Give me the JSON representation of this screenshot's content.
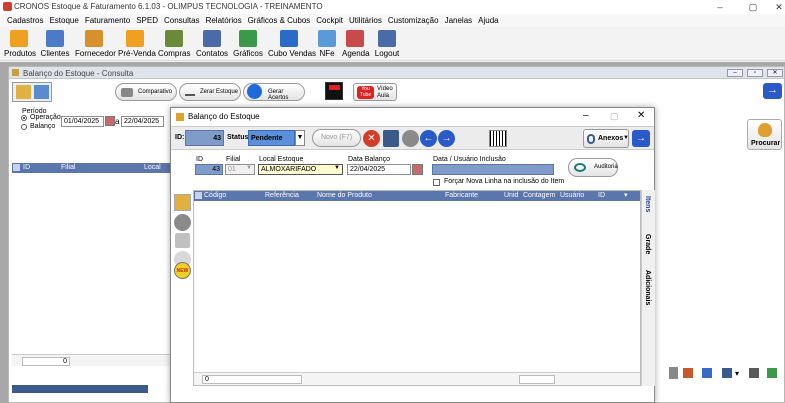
{
  "app": {
    "title": "CRONOS Estoque & Faturamento 6.1.03 - OLIMPUS TECNOLOGIA - TREINAMENTO",
    "window_controls": [
      "–",
      "▢",
      "✕"
    ]
  },
  "menu": [
    "Cadastros",
    "Estoque",
    "Faturamento",
    "SPED",
    "Consultas",
    "Relatórios",
    "Gráficos & Cubos",
    "Cockpit",
    "Utilitários",
    "Customização",
    "Janelas",
    "Ajuda"
  ],
  "toolbar": [
    {
      "label": "Produtos",
      "color": "#f0a020"
    },
    {
      "label": "Clientes",
      "color": "#4a7ac8"
    },
    {
      "label": "Fornecedor",
      "color": "#d8902a"
    },
    {
      "label": "Pré-Venda",
      "color": "#f0a020"
    },
    {
      "label": "Compras",
      "color": "#6a8a3a"
    },
    {
      "label": "Contatos",
      "color": "#4a6aa8"
    },
    {
      "label": "Gráficos",
      "color": "#3a9a4a"
    },
    {
      "label": "Cubo Vendas",
      "color": "#2a6ac8"
    },
    {
      "label": "NFe",
      "color": "#5a9ad8"
    },
    {
      "label": "Agenda",
      "color": "#c84a4a"
    },
    {
      "label": "Logout",
      "color": "#4a6aa8"
    }
  ],
  "consulta": {
    "title": "Balanço do Estoque - Consulta",
    "btn_comparativo": "Comparativo",
    "btn_zerar": "Zerar Estoque",
    "btn_gerar": "Gerar Acertos",
    "btn_video_logo": "You Tube",
    "btn_video": "Vídeo Aula",
    "periodo_label": "Período",
    "radio_operacao": "Operação",
    "radio_balanco": "Balanço",
    "date_from": "01/04/2025",
    "date_sep": "a",
    "date_to": "22/04/2025",
    "grid_cols": [
      "ID",
      "Filial",
      "Local Est"
    ],
    "footer_count": "0",
    "btn_procurar": "Procurar"
  },
  "dialog": {
    "title": "Balanço do Estoque",
    "id_label": "ID:",
    "id_value": "43",
    "status_label": "Status:",
    "status_value": "Pendente",
    "btn_novo": "Novo (F7)",
    "btn_anexos": "Anexos",
    "fields": {
      "id_label": "ID",
      "id_value": "43",
      "filial_label": "Filial",
      "filial_value": "01",
      "local_label": "Local Estoque",
      "local_value": "ALMOXARIFADO",
      "data_label": "Data Balanço",
      "data_value": "22/04/2025",
      "usuario_label": "Data / Usuário Inclusão",
      "auditoria": "Auditoria",
      "forcar_label": "Forçar Nova Linha na inclusão do Item"
    },
    "grid_cols": [
      "Código",
      "Referência",
      "Nome do Produto",
      "Fabricante",
      "Unid",
      "Contagem",
      "Usuário",
      "ID"
    ],
    "side_new": "NEW",
    "tabs": [
      "Itens",
      "Grade",
      "Adicionais"
    ],
    "footer_count": "0"
  },
  "colors": {
    "grid_header": "#5b75ad",
    "id_field": "#7e9bc9",
    "status_field": "#5b8fd8",
    "accent_blue": "#2a5ac8"
  }
}
